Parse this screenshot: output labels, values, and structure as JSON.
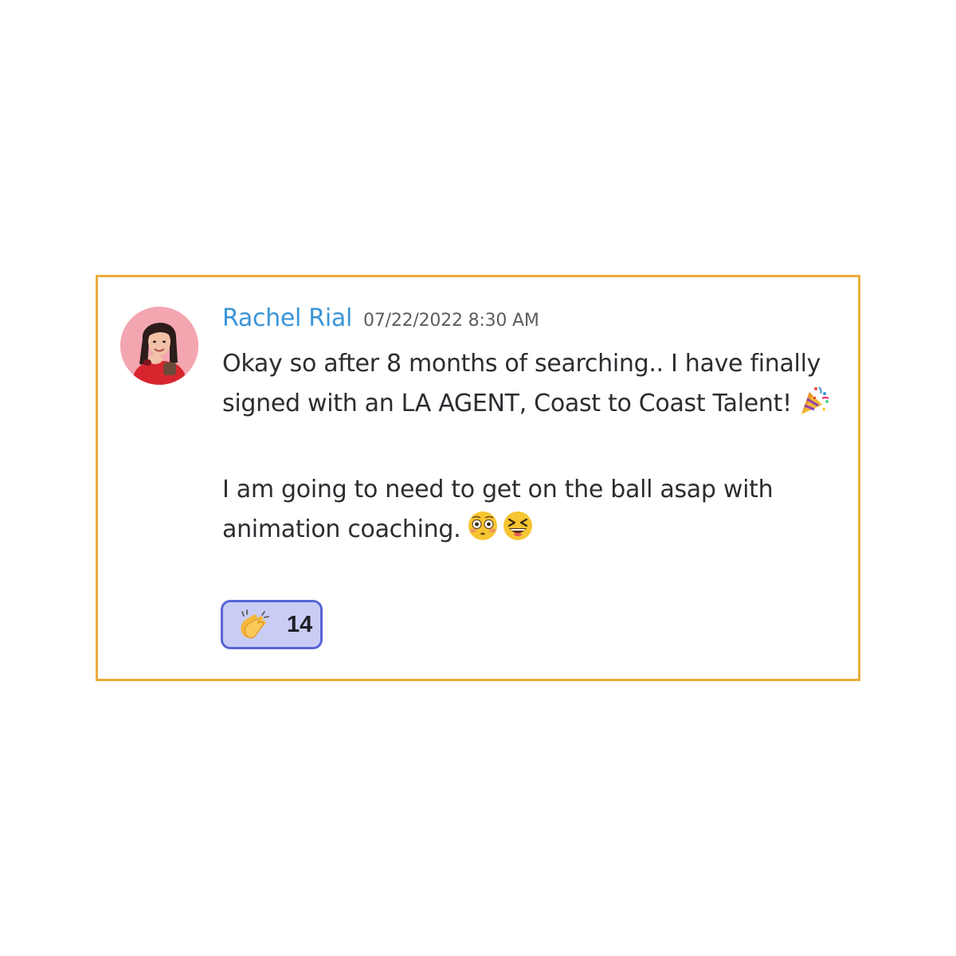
{
  "message": {
    "username": "Rachel Rial",
    "timestamp": "07/22/2022 8:30 AM",
    "paragraph1": "Okay so after 8 months of searching.. I have finally signed with an LA AGENT, Coast to Coast Talent!",
    "paragraph2": "I am going to need to get on the ball asap with animation coaching.",
    "inline_icons": [
      "party-popper-icon",
      "flushed-face-icon",
      "laughing-face-icon"
    ]
  },
  "reaction": {
    "icon": "clapping-hands-icon",
    "count": "14"
  },
  "colors": {
    "card_border": "#e9ad3b",
    "username": "#3a95d8",
    "reaction_border": "#5865d6",
    "reaction_fill": "#c9cdf5"
  }
}
